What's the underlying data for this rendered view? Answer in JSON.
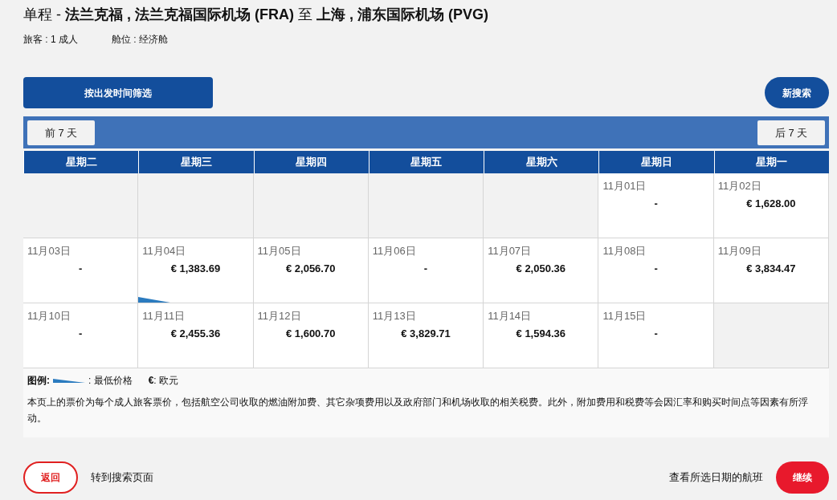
{
  "title": "单程 - **法兰克福 , 法兰克福国际机场 (FRA)** 至 **上海 , 浦东国际机场 (PVG)**",
  "passengers": "旅客 : 1 成人",
  "cabin": "舱位 : 经济舱",
  "filter_button": "按出发时间筛选",
  "new_search_button": "新搜索",
  "prev_button": "前 7 天",
  "next_button": "后 7 天",
  "weekdays": [
    "星期二",
    "星期三",
    "星期四",
    "星期五",
    "星期六",
    "星期日",
    "星期一"
  ],
  "weeks": [
    [
      {
        "kind": "blank"
      },
      {
        "kind": "blank"
      },
      {
        "kind": "blank"
      },
      {
        "kind": "blank"
      },
      {
        "kind": "blank"
      },
      {
        "kind": "day",
        "date": "11月01日",
        "price": "-",
        "lowest": false
      },
      {
        "kind": "day",
        "date": "11月02日",
        "price": "€ 1,628.00",
        "lowest": false
      }
    ],
    [
      {
        "kind": "day",
        "date": "11月03日",
        "price": "-",
        "lowest": false
      },
      {
        "kind": "day",
        "date": "11月04日",
        "price": "€ 1,383.69",
        "lowest": true
      },
      {
        "kind": "day",
        "date": "11月05日",
        "price": "€ 2,056.70",
        "lowest": false
      },
      {
        "kind": "day",
        "date": "11月06日",
        "price": "-",
        "lowest": false
      },
      {
        "kind": "day",
        "date": "11月07日",
        "price": "€ 2,050.36",
        "lowest": false
      },
      {
        "kind": "day",
        "date": "11月08日",
        "price": "-",
        "lowest": false
      },
      {
        "kind": "day",
        "date": "11月09日",
        "price": "€ 3,834.47",
        "lowest": false
      }
    ],
    [
      {
        "kind": "day",
        "date": "11月10日",
        "price": "-",
        "lowest": false
      },
      {
        "kind": "day",
        "date": "11月11日",
        "price": "€ 2,455.36",
        "lowest": false
      },
      {
        "kind": "day",
        "date": "11月12日",
        "price": "€ 1,600.70",
        "lowest": false
      },
      {
        "kind": "day",
        "date": "11月13日",
        "price": "€ 3,829.71",
        "lowest": false
      },
      {
        "kind": "day",
        "date": "11月14日",
        "price": "€ 1,594.36",
        "lowest": false
      },
      {
        "kind": "day",
        "date": "11月15日",
        "price": "-",
        "lowest": false
      },
      {
        "kind": "blank"
      }
    ]
  ],
  "legend": {
    "label": "图例:",
    "lowest_text": ": 最低价格",
    "currency_text": "**€**: 欧元"
  },
  "note": "本页上的票价为每个成人旅客票价，包括航空公司收取的燃油附加费、其它杂项费用以及政府部门和机场收取的相关税费。此外，附加费用和税费等会因汇率和购买时间点等因素有所浮动。",
  "back_button": "返回",
  "back_text": "转到搜索页面",
  "view_text": "查看所选日期的航班",
  "continue_button": "继续"
}
